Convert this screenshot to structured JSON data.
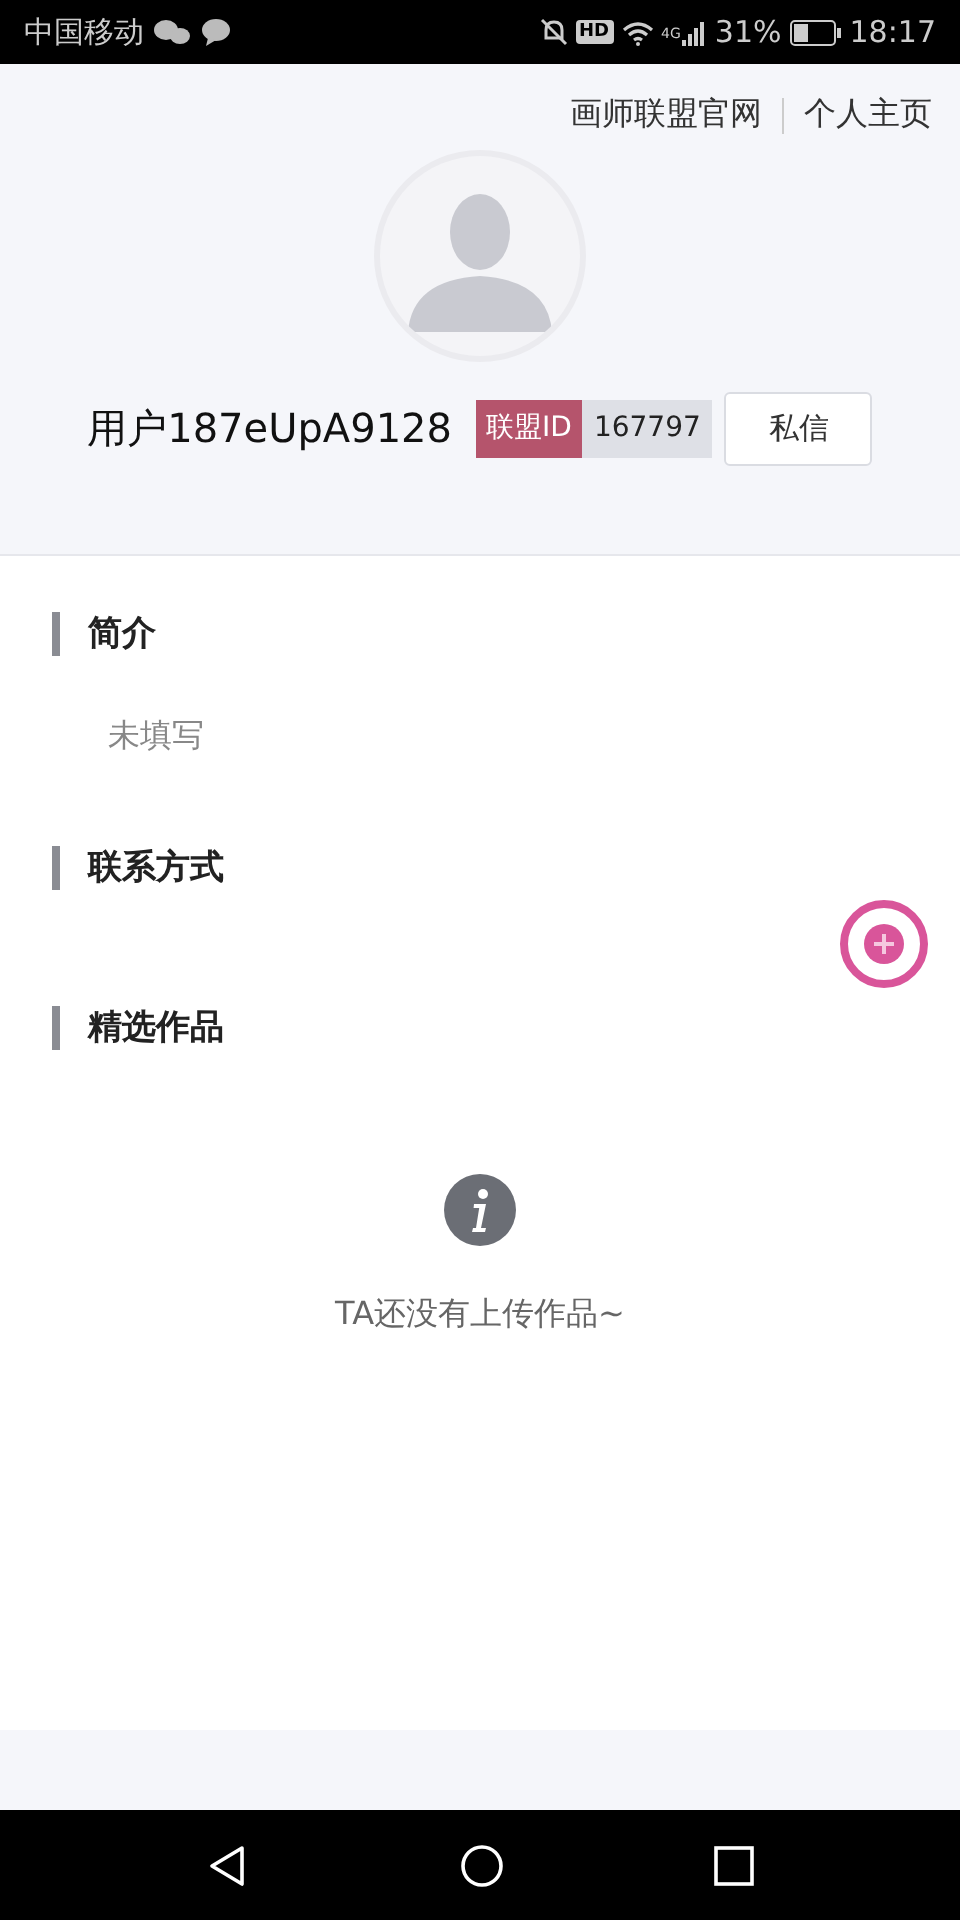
{
  "status_bar": {
    "carrier": "中国移动",
    "hd_badge": "HD",
    "network": "4G",
    "battery": "31%",
    "time": "18:17"
  },
  "header_links": [
    {
      "label": "画师联盟官网"
    },
    {
      "label": "个人主页"
    }
  ],
  "profile": {
    "username": "用户187eUpA9128",
    "id_label": "联盟ID",
    "id_value": "167797",
    "message_button": "私信"
  },
  "sections": [
    {
      "title": "简介",
      "body": "未填写"
    },
    {
      "title": "联系方式"
    },
    {
      "title": "精选作品"
    }
  ],
  "empty_state": {
    "text": "TA还没有上传作品~"
  }
}
